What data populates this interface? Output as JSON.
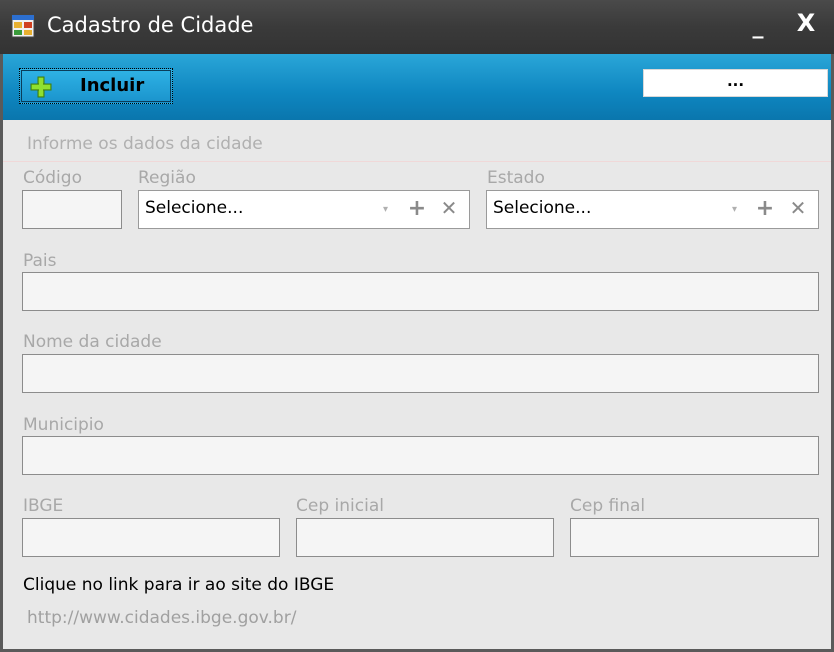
{
  "window": {
    "title": "Cadastro de Cidade",
    "minimize_glyph": "_",
    "close_glyph": "X"
  },
  "toolbar": {
    "incluir_label": "Incluir",
    "more_label": "..."
  },
  "panel": {
    "header": "Informe os dados da cidade"
  },
  "form": {
    "codigo": {
      "label": "Código",
      "value": ""
    },
    "regiao": {
      "label": "Região",
      "value": "Selecione..."
    },
    "estado": {
      "label": "Estado",
      "value": "Selecione..."
    },
    "pais": {
      "label": "Pais",
      "value": ""
    },
    "nome": {
      "label": "Nome da cidade",
      "value": ""
    },
    "municipio": {
      "label": "Municipio",
      "value": ""
    },
    "ibge": {
      "label": "IBGE",
      "value": ""
    },
    "cep_inicial": {
      "label": "Cep inicial",
      "value": ""
    },
    "cep_final": {
      "label": "Cep final",
      "value": ""
    }
  },
  "footer": {
    "info": "Clique no link para ir ao site do IBGE",
    "link": "http://www.cidades.ibge.gov.br/"
  },
  "icons": {
    "app": "form-app-icon",
    "add": "plus-icon",
    "remove": "x-icon",
    "dropdown": "chevron-down-icon"
  },
  "colors": {
    "toolbar": "#0e86c0",
    "titlebar": "#3a3a3a",
    "content": "#e8e8e8",
    "label": "#a8a8a8"
  }
}
